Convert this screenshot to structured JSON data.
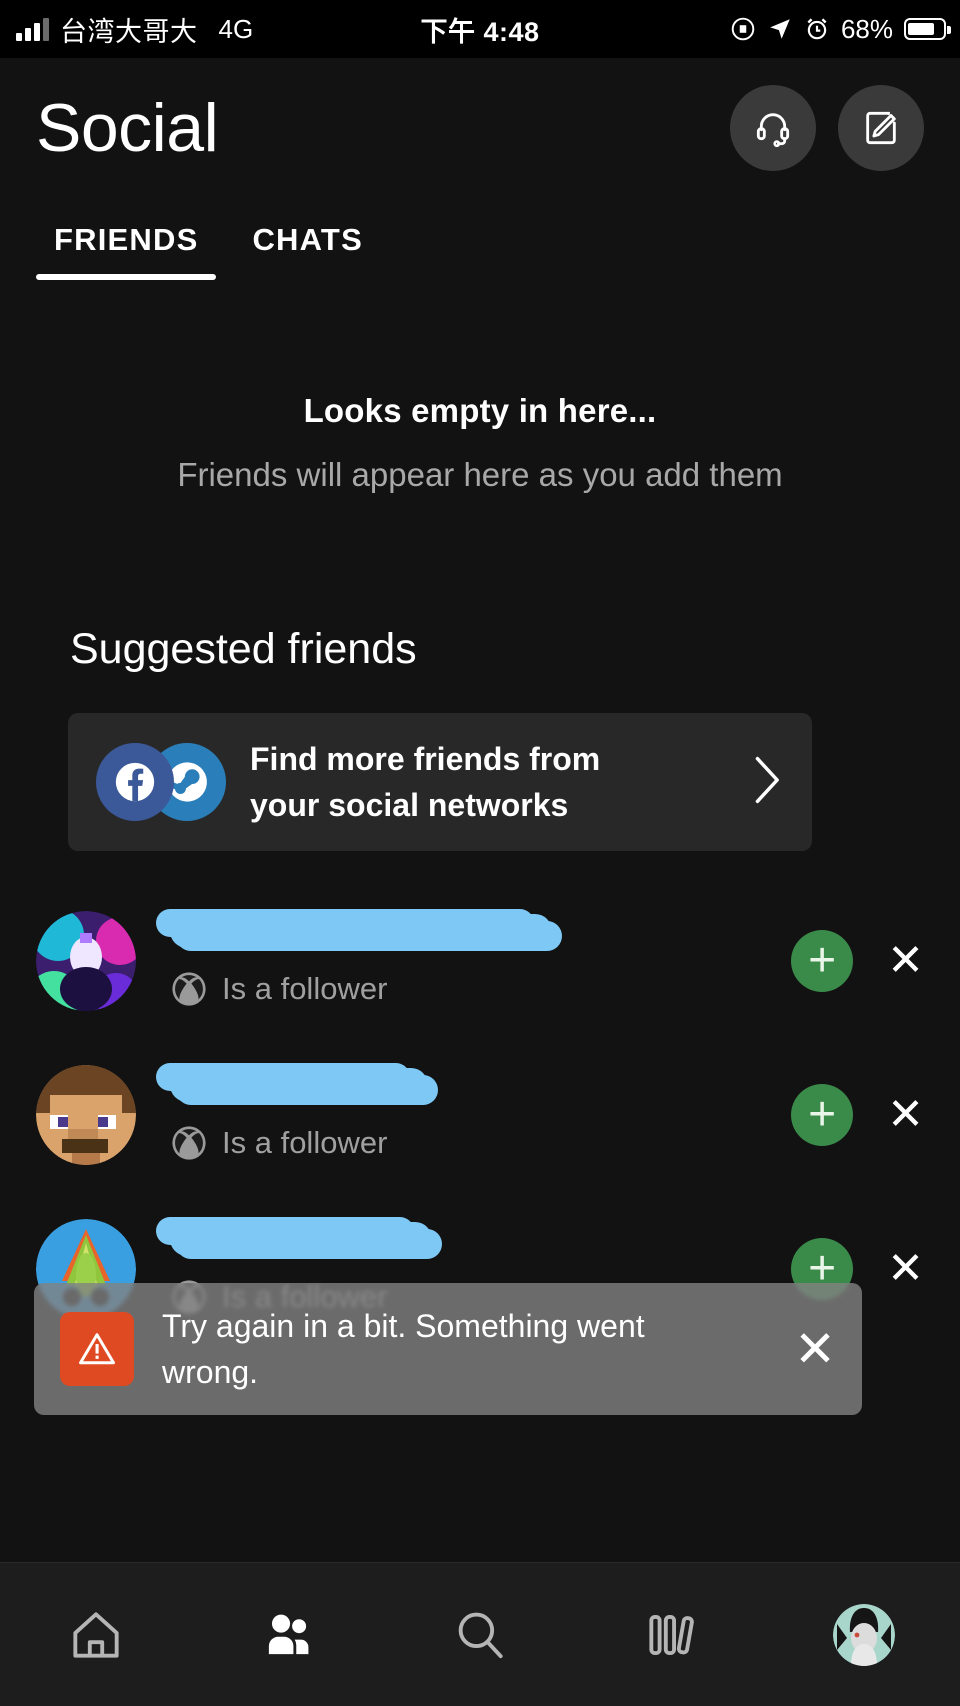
{
  "status_bar": {
    "carrier": "台湾大哥大",
    "network": "4G",
    "time": "下午 4:48",
    "battery_percent": "68%",
    "icons": [
      "signal-icon",
      "rotation-lock-icon",
      "location-arrow-icon",
      "alarm-icon",
      "battery-icon"
    ]
  },
  "header": {
    "title": "Social",
    "actions": [
      {
        "icon": "headset-icon",
        "name": "party-chat-button"
      },
      {
        "icon": "compose-icon",
        "name": "new-message-button"
      }
    ]
  },
  "tabs": [
    {
      "label": "FRIENDS",
      "active": true
    },
    {
      "label": "CHATS",
      "active": false
    }
  ],
  "empty_state": {
    "title": "Looks empty in here...",
    "subtitle": "Friends will appear here as you add them"
  },
  "suggested": {
    "section_title": "Suggested friends",
    "promo_card": {
      "line1": "Find more friends from",
      "line2": "your social networks",
      "icons": [
        "facebook-icon",
        "steam-icon"
      ],
      "chevron": "chevron-right-icon"
    },
    "rows": [
      {
        "name_redacted": true,
        "subtitle": "Is a follower",
        "platform_icon": "xbox-icon",
        "add_label": "+",
        "dismiss_label": "✕",
        "avatar": "avatar-neon-character"
      },
      {
        "name_redacted": true,
        "subtitle": "Is a follower",
        "platform_icon": "xbox-icon",
        "add_label": "+",
        "dismiss_label": "✕",
        "avatar": "avatar-minecraft-steve"
      },
      {
        "name_redacted": true,
        "subtitle": "Is a follower",
        "platform_icon": "xbox-icon",
        "add_label": "+",
        "dismiss_label": "✕",
        "avatar": "avatar-colorful-emblem"
      }
    ]
  },
  "toast": {
    "message": "Try again in a bit. Something went wrong.",
    "icon": "warning-icon",
    "close_label": "✕",
    "icon_color": "#e04a22"
  },
  "bottom_nav": [
    {
      "name": "nav-home",
      "icon": "home-icon",
      "active": false
    },
    {
      "name": "nav-social",
      "icon": "people-icon",
      "active": true
    },
    {
      "name": "nav-search",
      "icon": "search-icon",
      "active": false
    },
    {
      "name": "nav-library",
      "icon": "library-icon",
      "active": false
    },
    {
      "name": "nav-profile",
      "icon": "profile-avatar",
      "active": false
    }
  ],
  "colors": {
    "background": "#121212",
    "card": "#282828",
    "accent_green": "#3a8a4a",
    "redaction_blue": "#7ec8f5",
    "error_red": "#e04a22",
    "muted_text": "#a0a0a0"
  }
}
